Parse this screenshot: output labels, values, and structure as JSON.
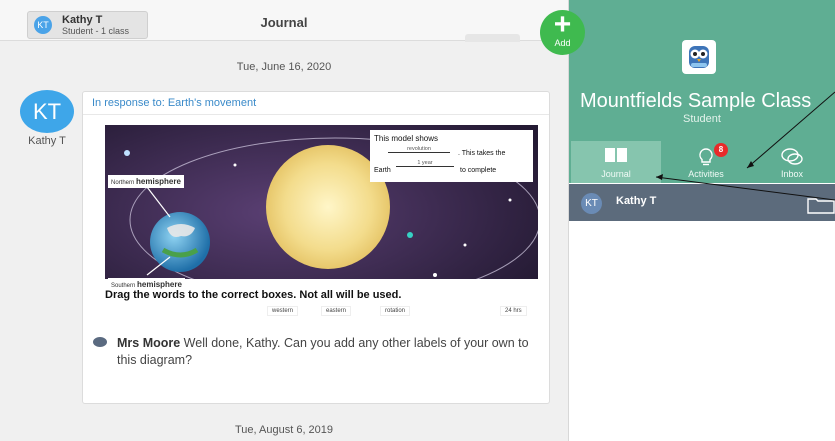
{
  "header": {
    "user": {
      "initials": "KT",
      "name": "Kathy T",
      "subtitle": "Student - 1 class"
    },
    "title": "Journal"
  },
  "add_button": {
    "label": "Add"
  },
  "feed": {
    "date_top": "Tue, June 16, 2020",
    "date_bottom": "Tue, August 6, 2019",
    "post": {
      "author_initials": "KT",
      "author_name": "Kathy T",
      "in_response_to": "In response to: Earth's movement",
      "activity": {
        "model_text_1": "This model shows",
        "blank_1": "revolution",
        "model_text_2": ". This takes the",
        "earth_label": "Earth",
        "blank_2": "1 year",
        "model_text_3": "to complete",
        "north_small": "Northern",
        "north_big": "hemisphere",
        "south_small": "Southern",
        "south_big": "hemisphere",
        "instruction": "Drag the words to the correct boxes. Not all will be used.",
        "words": [
          "western",
          "eastern",
          "rotation",
          "24 hrs"
        ]
      },
      "comment": {
        "author": "Mrs Moore",
        "text": " Well done, Kathy. Can you add any other labels of your own to this diagram?"
      }
    }
  },
  "class_panel": {
    "class_name": "Mountfields Sample Class",
    "role": "Student",
    "tabs": [
      {
        "label": "Journal",
        "icon": "book-icon",
        "active": true
      },
      {
        "label": "Activities",
        "icon": "lightbulb-icon",
        "badge": "8"
      },
      {
        "label": "Inbox",
        "icon": "chat-bubbles-icon"
      }
    ],
    "member": {
      "initials": "KT",
      "name": "Kathy T"
    }
  },
  "colors": {
    "accent_green": "#5fae93",
    "active_tab": "#86c5ae",
    "member_bar": "#5c6b7c",
    "add_green": "#3fba4f",
    "link_blue": "#3a8ac9",
    "badge_red": "#e82a2a"
  }
}
